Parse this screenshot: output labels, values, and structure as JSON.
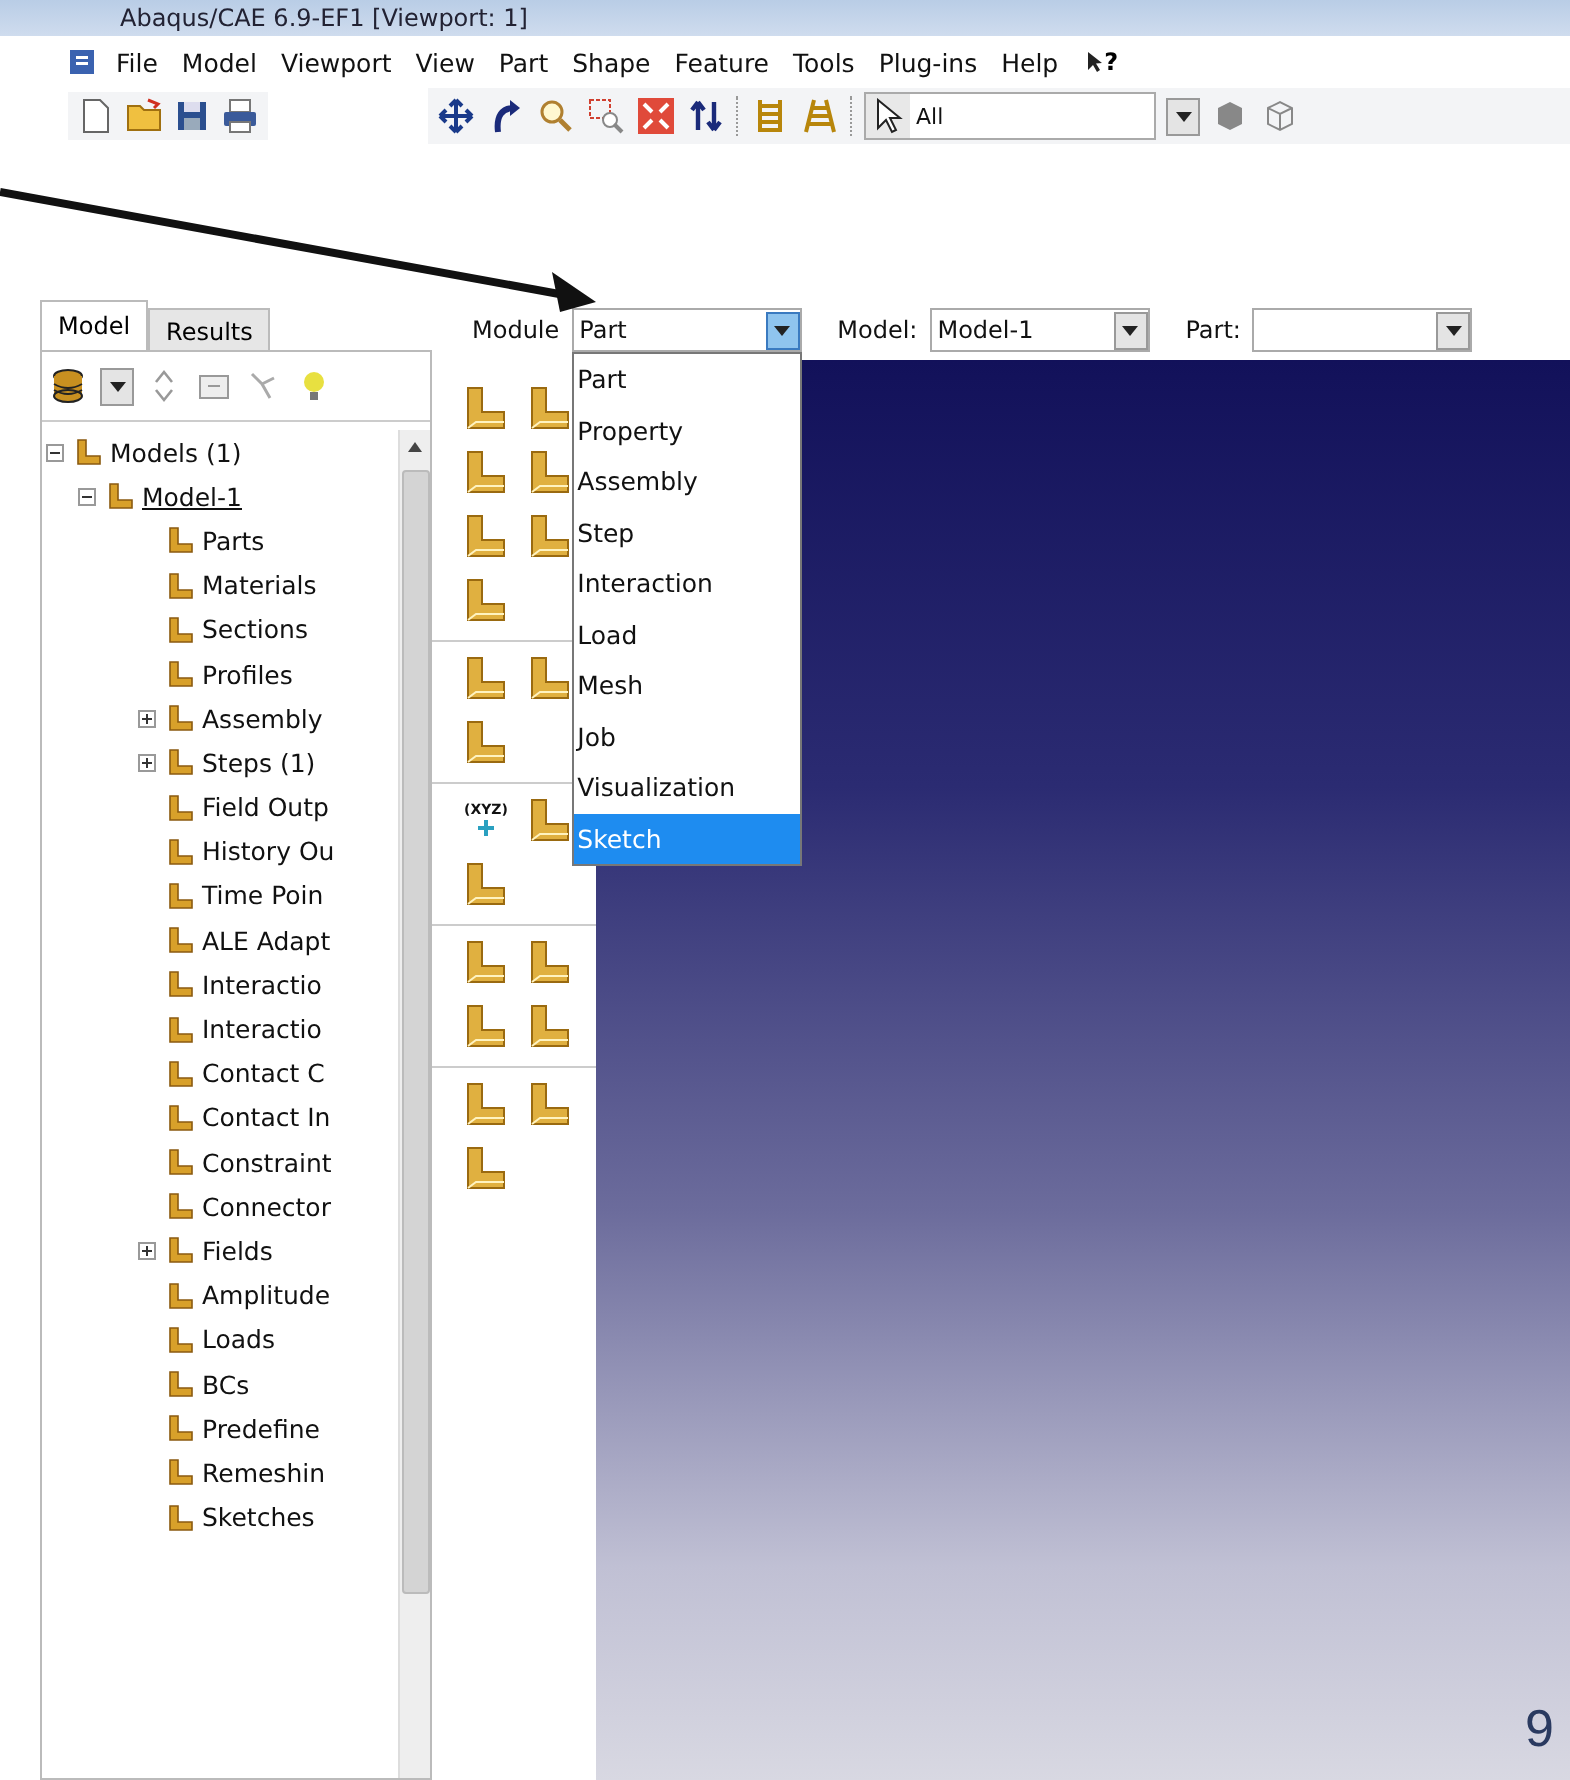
{
  "window": {
    "title": "Abaqus/CAE 6.9-EF1 [Viewport: 1]"
  },
  "menu": {
    "items": [
      "File",
      "Model",
      "Viewport",
      "View",
      "Part",
      "Shape",
      "Feature",
      "Tools",
      "Plug-ins",
      "Help"
    ],
    "help_glyph": "?"
  },
  "toolbar": {
    "selection_filter": "All"
  },
  "tabs": [
    {
      "label": "Model",
      "selected": true
    },
    {
      "label": "Results",
      "selected": false
    }
  ],
  "tree": [
    {
      "label": "Models (1)",
      "expanded": true,
      "children": [
        {
          "label": "Model-1",
          "expanded": true,
          "children": [
            {
              "label": "Parts"
            },
            {
              "label": "Materials"
            },
            {
              "label": "Sections"
            },
            {
              "label": "Profiles"
            },
            {
              "label": "Assembly",
              "expanded": false
            },
            {
              "label": "Steps (1)",
              "expanded": false
            },
            {
              "label": "Field Outp"
            },
            {
              "label": "History Ou"
            },
            {
              "label": "Time Poin"
            },
            {
              "label": "ALE Adapt"
            },
            {
              "label": "Interactio"
            },
            {
              "label": "Interactio"
            },
            {
              "label": "Contact C"
            },
            {
              "label": "Contact In"
            },
            {
              "label": "Constraint"
            },
            {
              "label": "Connector"
            },
            {
              "label": "Fields",
              "expanded": false
            },
            {
              "label": "Amplitude"
            },
            {
              "label": "Loads"
            },
            {
              "label": "BCs"
            },
            {
              "label": "Predefine"
            },
            {
              "label": "Remeshin"
            },
            {
              "label": "Sketches"
            }
          ]
        }
      ]
    }
  ],
  "context_bar": {
    "module_label": "Module",
    "module_value": "Part",
    "model_label": "Model:",
    "model_value": "Model-1",
    "part_label": "Part:"
  },
  "module_menu": [
    {
      "label": "Part",
      "selected": false
    },
    {
      "label": "Property",
      "selected": false
    },
    {
      "label": "Assembly",
      "selected": false
    },
    {
      "label": "Step",
      "selected": false
    },
    {
      "label": "Interaction",
      "selected": false
    },
    {
      "label": "Load",
      "selected": false
    },
    {
      "label": "Mesh",
      "selected": false
    },
    {
      "label": "Job",
      "selected": false
    },
    {
      "label": "Visualization",
      "selected": false
    },
    {
      "label": "Sketch",
      "selected": true
    }
  ],
  "toolbox": {
    "datum_label": "(XYZ)"
  },
  "page_number": "9"
}
